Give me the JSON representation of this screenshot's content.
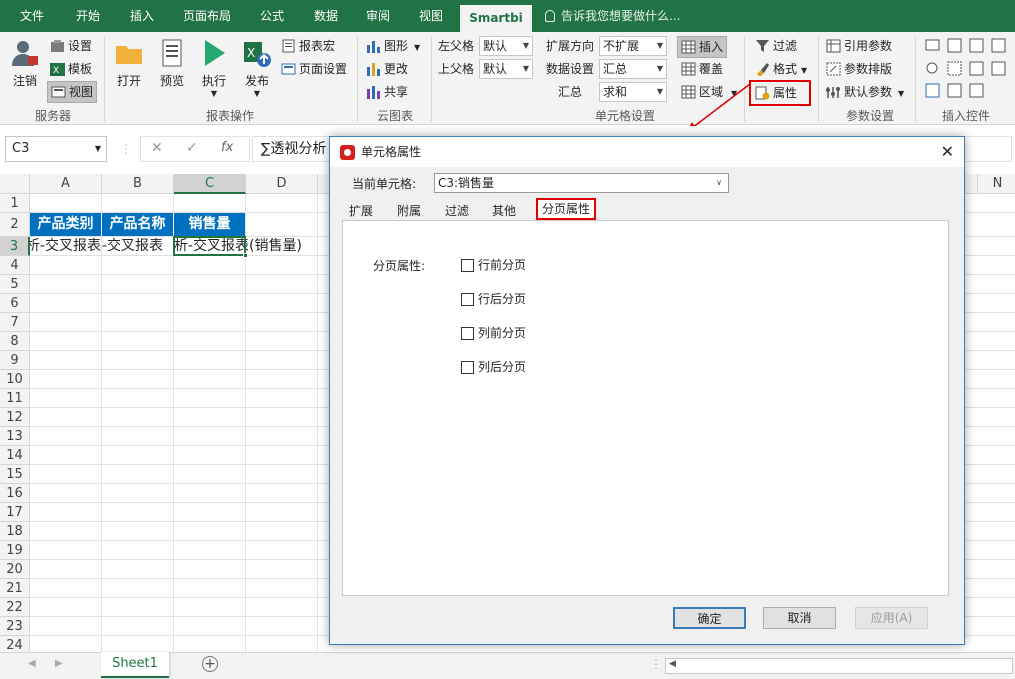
{
  "tabs": [
    {
      "label": "文件",
      "active": false
    },
    {
      "label": "开始",
      "active": false
    },
    {
      "label": "插入",
      "active": false
    },
    {
      "label": "页面布局",
      "active": false
    },
    {
      "label": "公式",
      "active": false
    },
    {
      "label": "数据",
      "active": false
    },
    {
      "label": "审阅",
      "active": false
    },
    {
      "label": "视图",
      "active": false
    },
    {
      "label": "Smartbi",
      "active": true
    }
  ],
  "tell_me": "告诉我您想要做什么...",
  "ribbon": {
    "server": {
      "logout": "注销",
      "settings": "设置",
      "template": "模板",
      "view": "视图",
      "group": "服务器"
    },
    "report_ops": {
      "open": "打开",
      "preview": "预览",
      "execute": "执行",
      "publish": "发布",
      "report_macro": "报表宏",
      "page_setup": "页面设置",
      "group": "报表操作"
    },
    "cloud_chart": {
      "graphic": "图形",
      "change": "更改",
      "share": "共享",
      "group": "云图表"
    },
    "cell_settings": {
      "left_parent": "左父格",
      "left_parent_value": "默认",
      "top_parent": "上父格",
      "top_parent_value": "默认",
      "expand_dir": "扩展方向",
      "expand_dir_value": "不扩展",
      "data_setting": "数据设置",
      "data_setting_value": "汇总",
      "summary": "汇总",
      "summary_value": "求和",
      "insert": "插入",
      "cover": "覆盖",
      "region": "区域",
      "group": "单元格设置"
    },
    "filter_group": {
      "filter": "过滤",
      "format": "格式",
      "property": "属性"
    },
    "param_settings": {
      "ref_param": "引用参数",
      "param_layout": "参数排版",
      "default_param": "默认参数",
      "group": "参数设置"
    },
    "insert_controls": {
      "group": "插入控件"
    }
  },
  "formula_bar": {
    "name_box": "C3",
    "formula": "∑透视分析"
  },
  "sheet": {
    "columns": [
      "A",
      "B",
      "C",
      "D",
      "N"
    ],
    "rows": [
      "1",
      "2",
      "3",
      "4",
      "5",
      "6",
      "7",
      "8",
      "9",
      "10",
      "11",
      "12",
      "13",
      "14",
      "15",
      "16",
      "17",
      "18",
      "19",
      "20",
      "21",
      "22",
      "23",
      "24"
    ],
    "row2": [
      "产品类别",
      "产品名称",
      "销售量"
    ],
    "row3": [
      "析-交叉报表",
      "-交叉报表",
      "析-交叉报表(销售量)"
    ],
    "tab": "Sheet1"
  },
  "dialog": {
    "title": "单元格属性",
    "current_cell_label": "当前单元格:",
    "current_cell_value": "C3:销售量",
    "tabs": [
      "扩展",
      "附属",
      "过滤",
      "其他",
      "分页属性"
    ],
    "active_tab": "分页属性",
    "section_label": "分页属性:",
    "options": [
      "行前分页",
      "行后分页",
      "列前分页",
      "列后分页"
    ],
    "buttons": {
      "ok": "确定",
      "cancel": "取消",
      "apply": "应用(A)"
    }
  },
  "colors": {
    "excel_green": "#217346",
    "highlight_red": "#e00000",
    "header_blue": "#0070c0"
  }
}
